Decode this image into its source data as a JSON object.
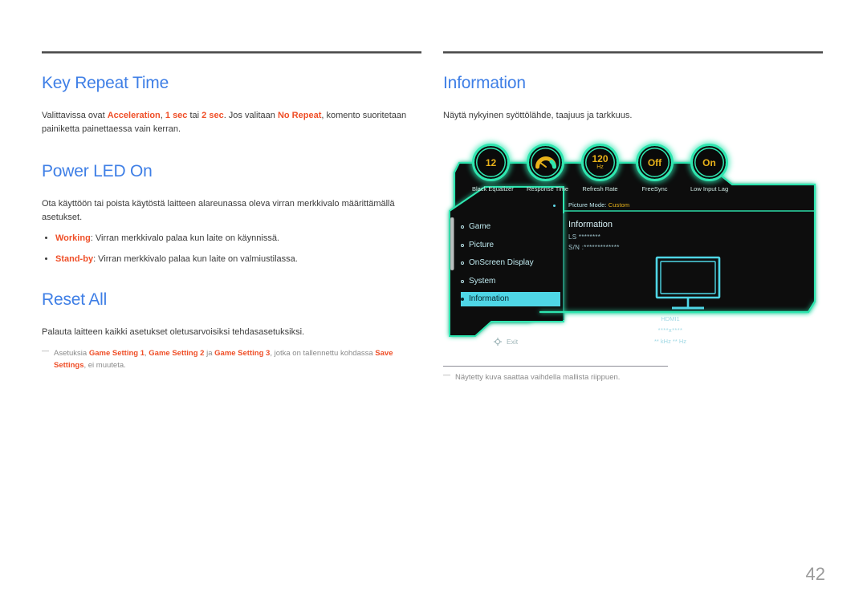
{
  "page_number": "42",
  "left_column": {
    "sections": [
      {
        "heading": "Key Repeat Time",
        "body_parts": [
          {
            "t": "Valittavissa ovat ",
            "style": "plain"
          },
          {
            "t": "Acceleration",
            "style": "accent"
          },
          {
            "t": ", ",
            "style": "plain"
          },
          {
            "t": "1 sec",
            "style": "accent"
          },
          {
            "t": " tai ",
            "style": "plain"
          },
          {
            "t": "2 sec",
            "style": "accent"
          },
          {
            "t": ". Jos valitaan ",
            "style": "plain"
          },
          {
            "t": "No Repeat",
            "style": "accent"
          },
          {
            "t": ", komento suoritetaan painiketta painettaessa vain kerran.",
            "style": "plain"
          }
        ]
      },
      {
        "heading": "Power LED On",
        "body": "Ota käyttöön tai poista käytöstä laitteen alareunassa oleva virran merkkivalo määrittämällä asetukset.",
        "bullets": [
          {
            "term": "Working",
            "text": ": Virran merkkivalo palaa kun laite on käynnissä."
          },
          {
            "term": "Stand-by",
            "text": ": Virran merkkivalo palaa kun laite on valmiustilassa."
          }
        ]
      },
      {
        "heading": "Reset All",
        "body": "Palauta laitteen kaikki asetukset oletusarvoisiksi tehdasasetuksiksi.",
        "note_parts": [
          {
            "t": "Asetuksia ",
            "style": "plain"
          },
          {
            "t": "Game Setting 1",
            "style": "accent"
          },
          {
            "t": ", ",
            "style": "plain"
          },
          {
            "t": "Game Setting 2",
            "style": "accent"
          },
          {
            "t": " ja ",
            "style": "plain"
          },
          {
            "t": "Game Setting 3",
            "style": "accent"
          },
          {
            "t": ", jotka on tallennettu kohdassa ",
            "style": "plain"
          },
          {
            "t": "Save Settings",
            "style": "accent"
          },
          {
            "t": ", ei muuteta.",
            "style": "plain"
          }
        ]
      }
    ]
  },
  "right_column": {
    "heading": "Information",
    "body": "Näytä nykyinen syöttölähde, taajuus ja tarkkuus.",
    "footnote": "Näytetty kuva saattaa vaihdella mallista riippuen."
  },
  "osd": {
    "dials": [
      {
        "value": "12",
        "unit": "",
        "label": "Black Equalizer",
        "kind": "value"
      },
      {
        "value": "",
        "unit": "",
        "label": "Response Time",
        "kind": "gauge"
      },
      {
        "value": "120",
        "unit": "Hz",
        "label": "Refresh Rate",
        "kind": "value"
      },
      {
        "value": "Off",
        "unit": "",
        "label": "FreeSync",
        "kind": "value"
      },
      {
        "value": "On",
        "unit": "",
        "label": "Low Input Lag",
        "kind": "value"
      }
    ],
    "picture_mode_label": "Picture Mode:",
    "picture_mode_value": "Custom",
    "menu_items": [
      {
        "label": "Game",
        "selected": false
      },
      {
        "label": "Picture",
        "selected": false
      },
      {
        "label": "OnScreen Display",
        "selected": false
      },
      {
        "label": "System",
        "selected": false
      },
      {
        "label": "Information",
        "selected": true
      }
    ],
    "exit_label": "Exit",
    "info_title": "Information",
    "info_ls": "LS ********",
    "info_sn": "S/N :*************",
    "monitor_input": "HDMI1",
    "monitor_resolution": "****x****",
    "monitor_frequency": "** kHz ** Hz"
  },
  "colors": {
    "heading_blue": "#3f7fe6",
    "accent_orange": "#ef4f28",
    "osd_cyan": "#2fe6b0",
    "osd_gold": "#e9b21a",
    "osd_highlight": "#4fd6e6",
    "page_number_gray": "#9a9a9a"
  }
}
